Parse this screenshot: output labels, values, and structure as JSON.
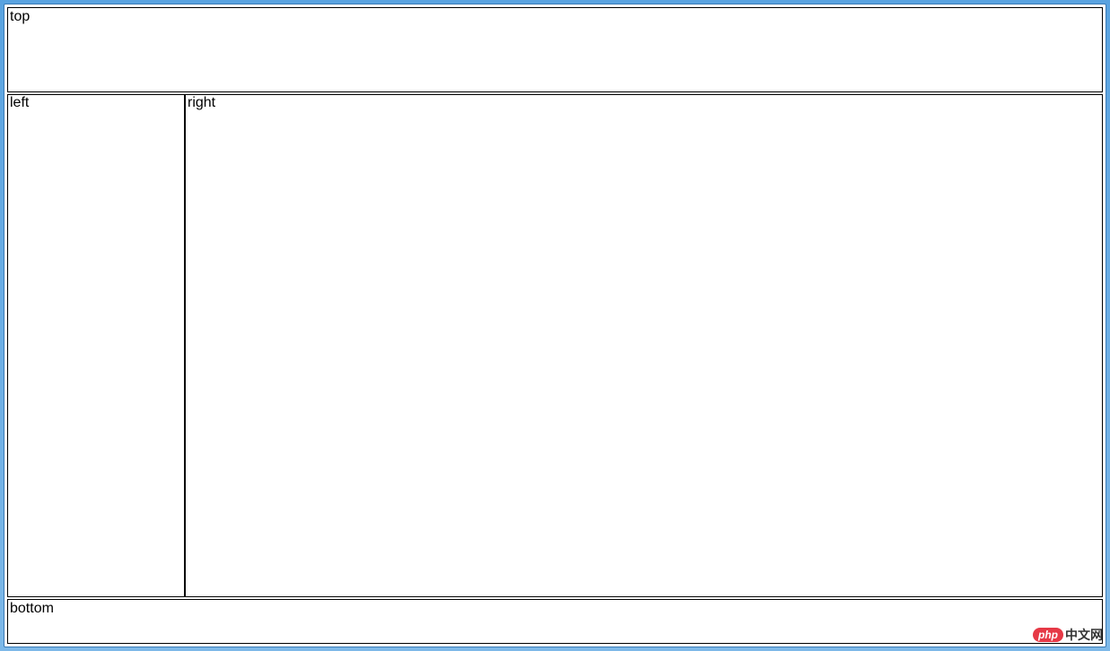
{
  "panels": {
    "top": "top",
    "left": "left",
    "right": "right",
    "bottom": "bottom"
  },
  "watermark": {
    "badge": "php",
    "text": "中文网"
  }
}
